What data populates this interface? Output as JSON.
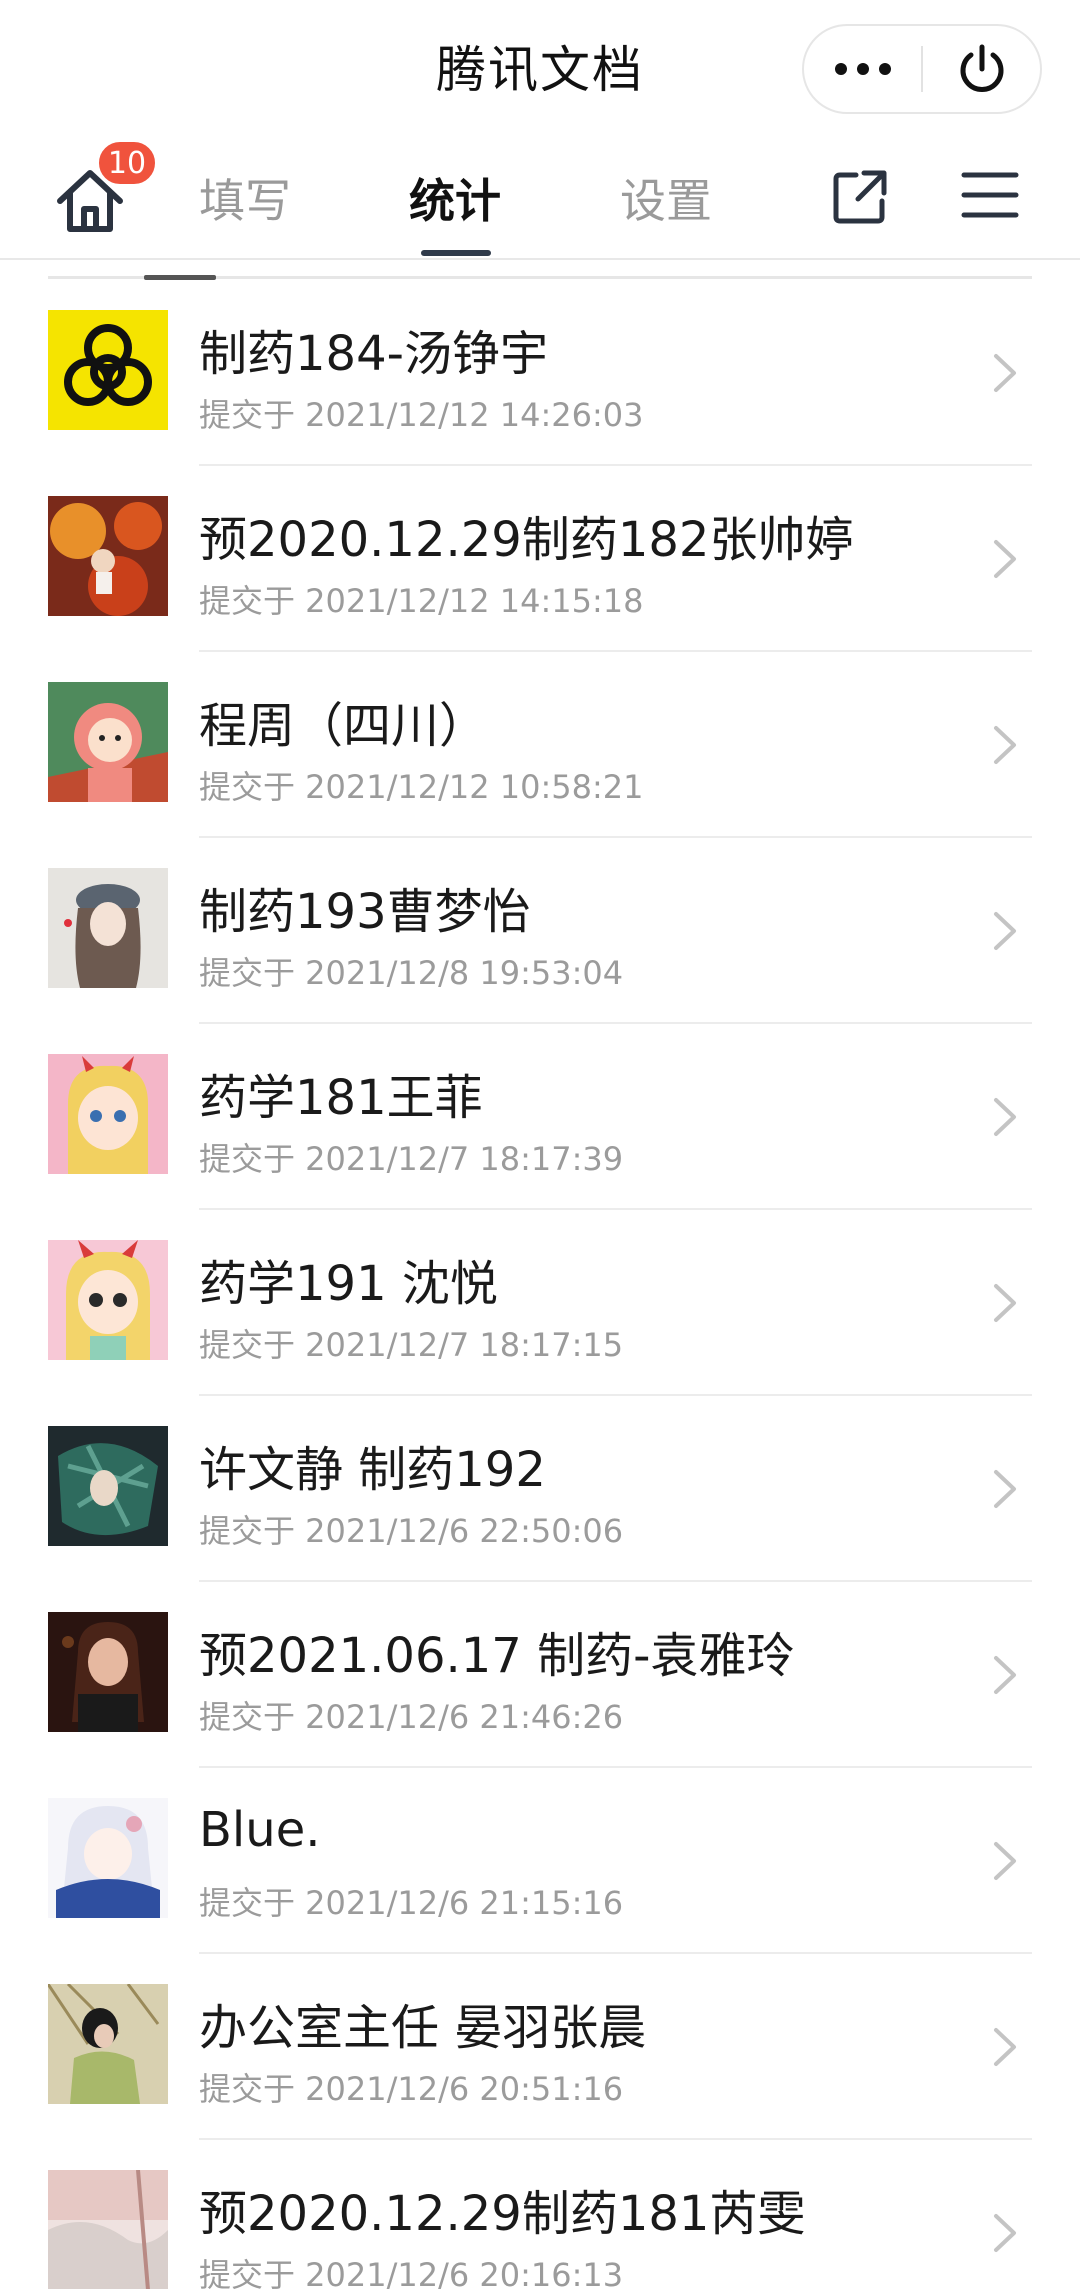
{
  "header": {
    "title": "腾讯文档",
    "more_icon": "more-dots-icon",
    "power_icon": "power-icon"
  },
  "tabbar": {
    "home_icon": "home-icon",
    "badge": "10",
    "tabs": [
      {
        "label": "填写",
        "active": false
      },
      {
        "label": "统计",
        "active": true
      },
      {
        "label": "设置",
        "active": false
      }
    ],
    "share_icon": "share-external-icon",
    "menu_icon": "hamburger-menu-icon"
  },
  "colors": {
    "badge": "#f0533d",
    "active_tab": "#111111",
    "inactive_tab": "#9a9a9a",
    "timestamp": "#9b9b9b"
  },
  "submissions": [
    {
      "name": "制药184-汤铮宇",
      "time": "提交于 2021/12/12 14:26:03"
    },
    {
      "name": "预2020.12.29制药182张帅婷",
      "time": "提交于 2021/12/12 14:15:18"
    },
    {
      "name": "程周（四川）",
      "time": "提交于 2021/12/12 10:58:21"
    },
    {
      "name": "制药193曹梦怡",
      "time": "提交于 2021/12/8 19:53:04"
    },
    {
      "name": "药学181王菲",
      "time": "提交于 2021/12/7 18:17:39"
    },
    {
      "name": "药学191 沈悦",
      "time": "提交于 2021/12/7 18:17:15"
    },
    {
      "name": "许文静 制药192",
      "time": "提交于 2021/12/6 22:50:06"
    },
    {
      "name": "预2021.06.17 制药-袁雅玲",
      "time": "提交于 2021/12/6 21:46:26"
    },
    {
      "name": "Blue.",
      "time": "提交于 2021/12/6 21:15:16"
    },
    {
      "name": "办公室主任 晏羽张晨",
      "time": "提交于 2021/12/6 20:51:16"
    },
    {
      "name": "预2020.12.29制药181芮雯",
      "time": "提交于 2021/12/6 20:16:13"
    }
  ]
}
